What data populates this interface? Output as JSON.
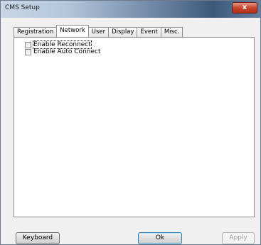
{
  "window": {
    "title": "CMS Setup",
    "close_glyph": "x"
  },
  "tabs": [
    {
      "label": "Registration",
      "active": false
    },
    {
      "label": "Network",
      "active": true
    },
    {
      "label": "User",
      "active": false
    },
    {
      "label": "Display",
      "active": false
    },
    {
      "label": "Event",
      "active": false
    },
    {
      "label": "Misc.",
      "active": false
    }
  ],
  "network": {
    "options": [
      {
        "label": "Enable Reconnect",
        "checked": false
      },
      {
        "label": "Enable Auto Connect",
        "checked": false
      }
    ]
  },
  "buttons": {
    "keyboard": "Keyboard",
    "ok": "Ok",
    "apply": "Apply"
  },
  "colors": {
    "close_button": "#c9452c",
    "default_button_border": "#3c7fb1"
  }
}
